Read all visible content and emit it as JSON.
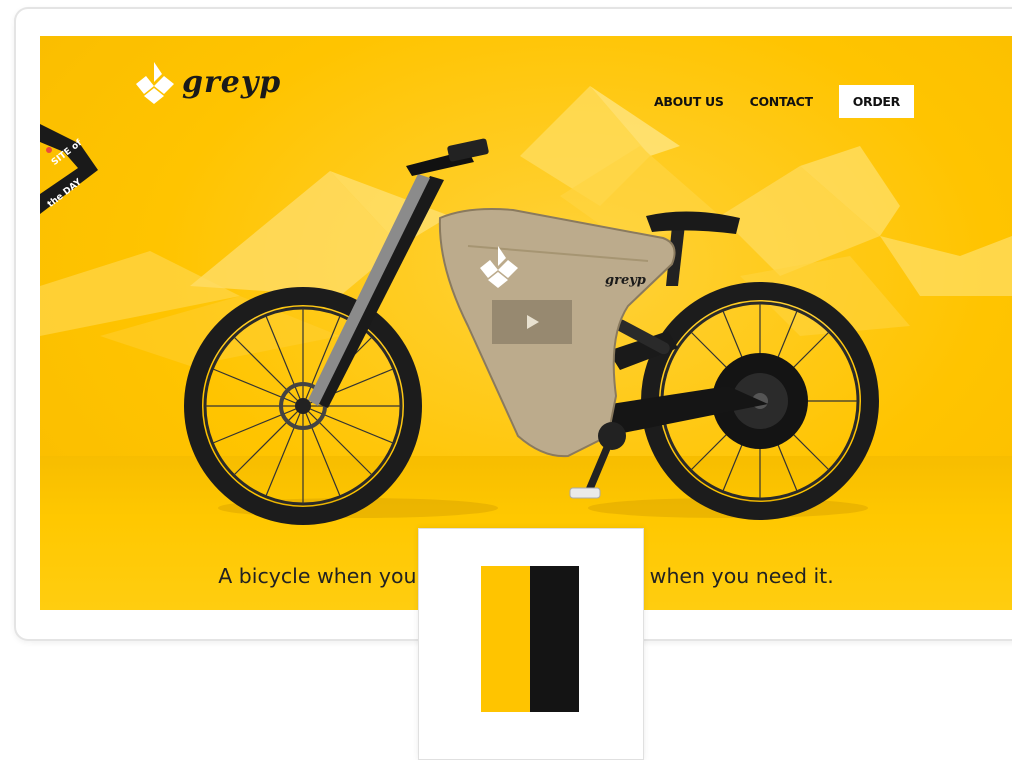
{
  "brand": {
    "name": "greyp"
  },
  "nav": {
    "about_label": "ABOUT US",
    "contact_label": "CONTACT",
    "order_label": "ORDER"
  },
  "ribbon": {
    "line1": "SITE of",
    "line2": "the DAY"
  },
  "bike": {
    "logo_text": "greyp"
  },
  "hero": {
    "tagline_left": "A bicycle when you",
    "tagline_right": "e when you need it."
  },
  "colors": {
    "brand_yellow": "#ffc400",
    "brand_black": "#141414",
    "frame_beige": "#b8a98a"
  },
  "palette": {
    "swatches": [
      {
        "name": "yellow",
        "color": "#ffc400"
      },
      {
        "name": "black",
        "color": "#141414"
      }
    ]
  }
}
